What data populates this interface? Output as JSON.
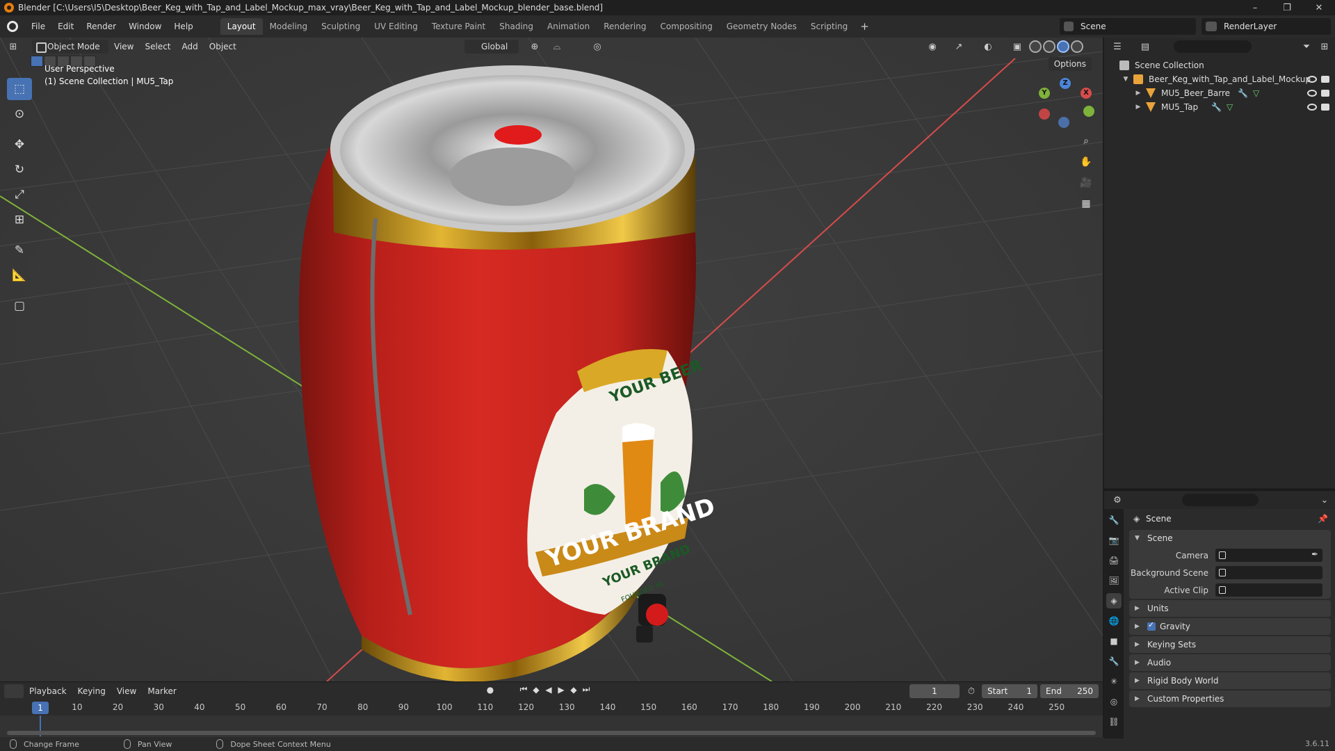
{
  "window": {
    "title": "Blender [C:\\Users\\I5\\Desktop\\Beer_Keg_with_Tap_and_Label_Mockup_max_vray\\Beer_Keg_with_Tap_and_Label_Mockup_blender_base.blend]",
    "minimize": "–",
    "maximize": "❐",
    "close": "✕"
  },
  "menubar": {
    "items": [
      "File",
      "Edit",
      "Render",
      "Window",
      "Help"
    ],
    "workspaces": [
      "Layout",
      "Modeling",
      "Sculpting",
      "UV Editing",
      "Texture Paint",
      "Shading",
      "Animation",
      "Rendering",
      "Compositing",
      "Geometry Nodes",
      "Scripting"
    ],
    "active_workspace": "Layout",
    "add_tab": "+",
    "scene": "Scene",
    "render_layer": "RenderLayer"
  },
  "viewport": {
    "mode": "Object Mode",
    "menus": [
      "View",
      "Select",
      "Add",
      "Object"
    ],
    "orientation": "Global",
    "options": "Options",
    "perspective_label": "User Perspective",
    "collection_label": "(1) Scene Collection | MU5_Tap",
    "gizmo": {
      "x": "X",
      "y": "Y",
      "z": "Z"
    },
    "label_text": {
      "top": "YOUR BEER",
      "ribbon": "YOUR BRAND",
      "sub": "YOUR BRAND",
      "founded": "FOUNDED IN"
    }
  },
  "timeline": {
    "menus": [
      "Playback",
      "Keying",
      "View",
      "Marker"
    ],
    "current_frame": "1",
    "start_label": "Start",
    "start": "1",
    "end_label": "End",
    "end": "250",
    "ticks": [
      "1",
      "10",
      "20",
      "30",
      "40",
      "50",
      "60",
      "70",
      "80",
      "90",
      "100",
      "110",
      "120",
      "130",
      "140",
      "150",
      "160",
      "170",
      "180",
      "190",
      "200",
      "210",
      "220",
      "230",
      "240",
      "250"
    ]
  },
  "statusbar": {
    "items": [
      "Change Frame",
      "Pan View",
      "Dope Sheet Context Menu"
    ],
    "version": "3.6.11"
  },
  "outliner": {
    "root": "Scene Collection",
    "collection": "Beer_Keg_with_Tap_and_Label_Mockup",
    "objects": [
      "MU5_Beer_Barre",
      "MU5_Tap"
    ]
  },
  "properties": {
    "context": "Scene",
    "panel_scene": "Scene",
    "camera_label": "Camera",
    "background_label": "Background Scene",
    "clip_label": "Active Clip",
    "collapsed_panels": [
      "Units",
      "Gravity",
      "Keying Sets",
      "Audio",
      "Rigid Body World",
      "Custom Properties"
    ]
  },
  "colors": {
    "accent": "#4772b3",
    "keg_red": "#c8231d",
    "keg_gold": "#c99a1a",
    "axis_x": "#d94b4b",
    "axis_y": "#7fb23a"
  }
}
